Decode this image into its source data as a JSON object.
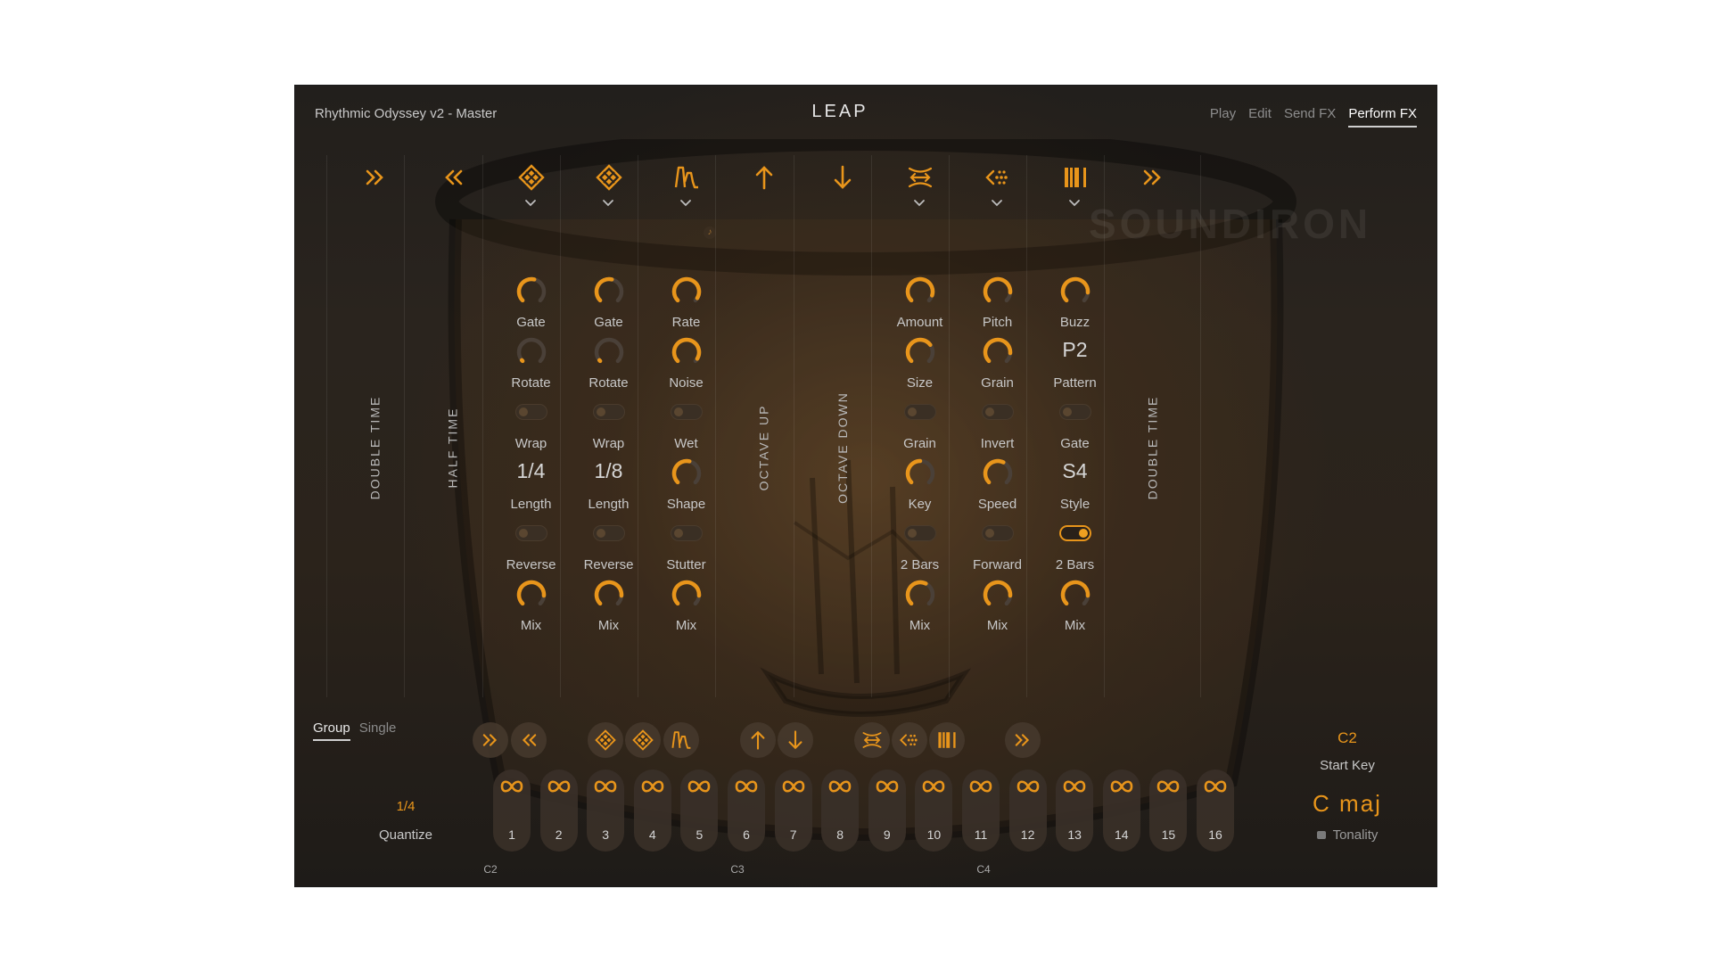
{
  "header": {
    "instrument_title": "Rhythmic Odyssey v2 - Master",
    "logo": "LEAP",
    "tabs": [
      {
        "label": "Play",
        "active": false
      },
      {
        "label": "Edit",
        "active": false
      },
      {
        "label": "Send FX",
        "active": false
      },
      {
        "label": "Perform FX",
        "active": true
      }
    ]
  },
  "watermark": "SOUNDIRON",
  "colors": {
    "accent": "#e8951b",
    "panel_bg": "#241f1b",
    "text": "#c8c8c8"
  },
  "columns": [
    {
      "icon": "double-time-icon",
      "vertical_label": "DOUBLE TIME"
    },
    {
      "icon": "half-time-icon",
      "vertical_label": "HALF TIME"
    },
    {
      "icon": "glitch-diamond-icon",
      "has_dropdown": true,
      "knob1": {
        "label": "Gate",
        "value": 0.55
      },
      "knob2": {
        "label": "Rotate",
        "value": 0.0
      },
      "toggle1": {
        "label": "Wrap",
        "on": false
      },
      "value3": {
        "value": "1/4",
        "label": "Length"
      },
      "toggle2": {
        "label": "Reverse",
        "on": false
      },
      "mix": {
        "label": "Mix",
        "value": 0.85
      }
    },
    {
      "icon": "glitch-diamond-icon",
      "has_dropdown": true,
      "knob1": {
        "label": "Gate",
        "value": 0.55
      },
      "knob2": {
        "label": "Rotate",
        "value": 0.0
      },
      "toggle1": {
        "label": "Wrap",
        "on": false
      },
      "value3": {
        "value": "1/8",
        "label": "Length"
      },
      "toggle2": {
        "label": "Reverse",
        "on": false
      },
      "mix": {
        "label": "Mix",
        "value": 0.85
      }
    },
    {
      "icon": "lofi-wave-icon",
      "has_dropdown": true,
      "knob1": {
        "label": "Rate",
        "value": 0.95
      },
      "knob2": {
        "label": "Noise",
        "value": 0.95
      },
      "toggle1": {
        "label": "Wet",
        "on": false
      },
      "knob3": {
        "label": "Shape",
        "value": 0.55
      },
      "toggle2": {
        "label": "Stutter",
        "on": false
      },
      "mix": {
        "label": "Mix",
        "value": 0.85
      }
    },
    {
      "icon": "arrow-up-icon",
      "vertical_label": "OCTAVE UP"
    },
    {
      "icon": "arrow-down-icon",
      "vertical_label": "OCTAVE DOWN"
    },
    {
      "icon": "stretch-icon",
      "has_dropdown": true,
      "knob1": {
        "label": "Amount",
        "value": 0.9
      },
      "knob2": {
        "label": "Size",
        "value": 0.7
      },
      "toggle1": {
        "label": "Grain",
        "on": false
      },
      "knob3": {
        "label": "Key",
        "value": 0.5
      },
      "toggle2": {
        "label": "2 Bars",
        "on": false
      },
      "mix": {
        "label": "Mix",
        "value": 0.6
      }
    },
    {
      "icon": "granular-icon",
      "has_dropdown": true,
      "knob1": {
        "label": "Pitch",
        "value": 0.85
      },
      "knob2": {
        "label": "Grain",
        "value": 0.85
      },
      "toggle1": {
        "label": "Invert",
        "on": false
      },
      "knob3": {
        "label": "Speed",
        "value": 0.6
      },
      "toggle2": {
        "label": "Forward",
        "on": false
      },
      "mix": {
        "label": "Mix",
        "value": 0.85
      }
    },
    {
      "icon": "buzz-bars-icon",
      "has_dropdown": true,
      "knob1": {
        "label": "Buzz",
        "value": 0.85
      },
      "value2": {
        "value": "P2",
        "label": "Pattern"
      },
      "toggle1": {
        "label": "Gate",
        "on": false
      },
      "value3": {
        "value": "S4",
        "label": "Style"
      },
      "toggle2": {
        "label": "2 Bars",
        "on": true
      },
      "mix": {
        "label": "Mix",
        "value": 0.85
      }
    },
    {
      "icon": "double-time-icon",
      "vertical_label": "DOUBLE TIME"
    }
  ],
  "bottom": {
    "mode_tabs": [
      {
        "label": "Group",
        "active": true
      },
      {
        "label": "Single",
        "active": false
      }
    ],
    "quantize": {
      "value": "1/4",
      "label": "Quantize"
    },
    "fx_buttons": [
      "double-time-icon",
      "half-time-icon",
      "glitch-diamond-icon",
      "glitch-diamond-icon",
      "lofi-wave-icon",
      "arrow-up-icon",
      "arrow-down-icon",
      "stretch-icon",
      "granular-icon",
      "buzz-bars-icon",
      "double-time-icon"
    ],
    "pads": [
      "1",
      "2",
      "3",
      "4",
      "5",
      "6",
      "7",
      "8",
      "9",
      "10",
      "11",
      "12",
      "13",
      "14",
      "15",
      "16"
    ],
    "octave_marks": [
      "C2",
      "C3",
      "C4"
    ],
    "start_key": {
      "value": "C2",
      "label": "Start Key"
    },
    "tonality": {
      "value": "C maj",
      "label": "Tonality"
    }
  }
}
